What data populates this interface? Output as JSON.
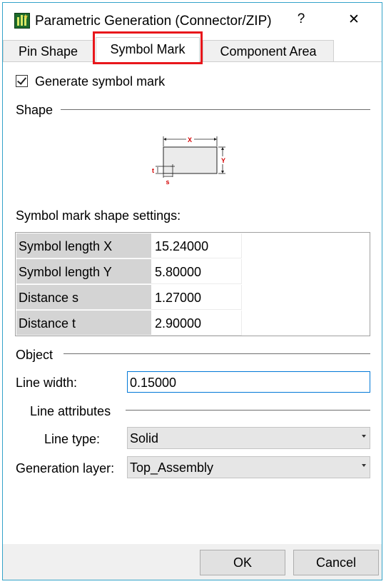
{
  "window": {
    "title": "Parametric Generation (Connector/ZIP)",
    "help_glyph": "?",
    "close_glyph": "✕"
  },
  "tabs": [
    {
      "label": "Pin Shape",
      "active": false
    },
    {
      "label": "Symbol Mark",
      "active": true
    },
    {
      "label": "Component Area",
      "active": false
    }
  ],
  "generate_symbol": {
    "label": "Generate symbol mark",
    "checked": true
  },
  "shape": {
    "title": "Shape",
    "diagram": {
      "x_label": "X",
      "y_label": "Y",
      "s_label": "s",
      "t_label": "t"
    }
  },
  "settings": {
    "title": "Symbol mark shape settings:",
    "rows": [
      {
        "key": "Symbol length X",
        "value": "15.24000"
      },
      {
        "key": "Symbol length Y",
        "value": "5.80000"
      },
      {
        "key": "Distance s",
        "value": "1.27000"
      },
      {
        "key": "Distance t",
        "value": "2.90000"
      }
    ]
  },
  "object": {
    "title": "Object",
    "line_width": {
      "label": "Line width:",
      "value": "0.15000"
    },
    "line_attributes": {
      "title": "Line attributes"
    },
    "line_type": {
      "label": "Line type:",
      "value": "Solid"
    },
    "generation_layer": {
      "label": "Generation layer:",
      "value": "Top_Assembly"
    }
  },
  "buttons": {
    "ok": "OK",
    "cancel": "Cancel"
  },
  "colors": {
    "accent_border": "#0078d7",
    "highlight": "#e8161b",
    "dimension_red": "#d40000"
  }
}
